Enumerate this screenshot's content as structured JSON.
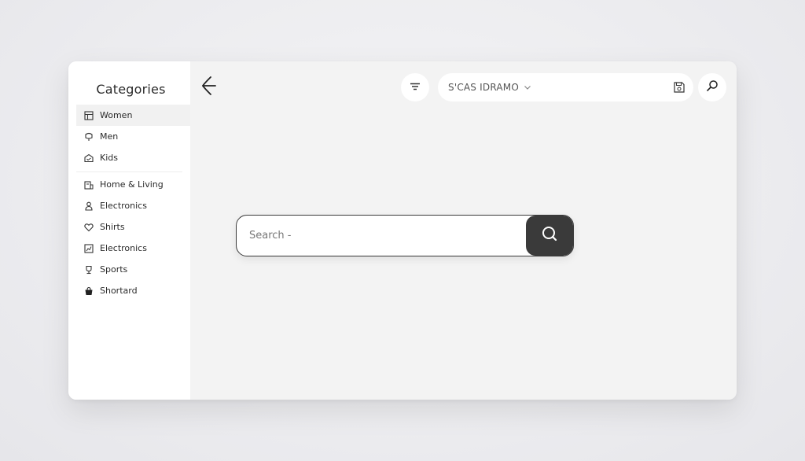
{
  "sidebar": {
    "title": "Categories",
    "items": [
      {
        "label": "Women",
        "icon": "grid-icon"
      },
      {
        "label": "Men",
        "icon": "shirt-icon"
      },
      {
        "label": "Kids",
        "icon": "basket-icon"
      },
      {
        "label": "Home & Living",
        "icon": "home-icon"
      },
      {
        "label": "Electronics",
        "icon": "person-icon"
      },
      {
        "label": "Shirts",
        "icon": "heart-icon"
      },
      {
        "label": "Electronics",
        "icon": "chart-icon"
      },
      {
        "label": "Sports",
        "icon": "trophy-icon"
      },
      {
        "label": "Shortard",
        "icon": "bag-icon"
      }
    ]
  },
  "header": {
    "store_select_value": "S'CAS IDRAMO"
  },
  "search": {
    "placeholder": "Search -"
  },
  "colors": {
    "accent_dark": "#3a3a3a",
    "sidebar_bg": "#ffffff",
    "main_bg": "#f3f3f3"
  }
}
